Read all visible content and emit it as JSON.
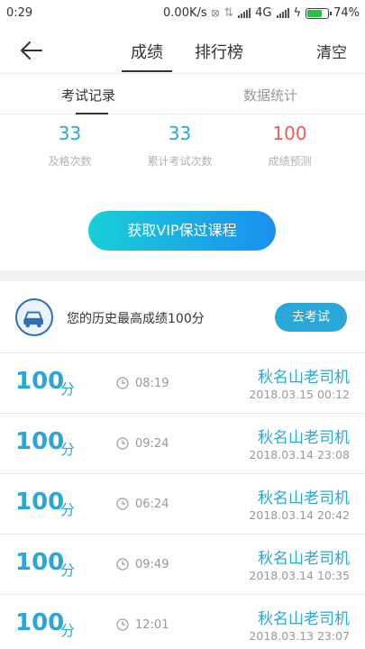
{
  "status_bar": {
    "time": "0:29",
    "speed": "0.00K/s",
    "network": "4G",
    "battery": "74%",
    "battery_level": 0.74
  },
  "header": {
    "tabs": [
      "成绩",
      "排行榜"
    ],
    "active_tab": 0,
    "clear_label": "清空"
  },
  "sub_tabs": {
    "items": [
      "考试记录",
      "数据统计"
    ],
    "active": 0
  },
  "stats": [
    {
      "value": "33",
      "label": "及格次数"
    },
    {
      "value": "33",
      "label": "累计考试次数"
    },
    {
      "value": "100",
      "label": "成绩预测"
    }
  ],
  "vip_button": "获取VIP保过课程",
  "best": {
    "text": "您的历史最高成绩100分",
    "button": "去考试"
  },
  "records": [
    {
      "score": "100",
      "unit": "分",
      "duration": "08:19",
      "name": "秋名山老司机",
      "date": "2018.03.15  00:12"
    },
    {
      "score": "100",
      "unit": "分",
      "duration": "09:24",
      "name": "秋名山老司机",
      "date": "2018.03.14  23:08"
    },
    {
      "score": "100",
      "unit": "分",
      "duration": "06:24",
      "name": "秋名山老司机",
      "date": "2018.03.14  20:42"
    },
    {
      "score": "100",
      "unit": "分",
      "duration": "09:49",
      "name": "秋名山老司机",
      "date": "2018.03.14  10:35"
    },
    {
      "score": "100",
      "unit": "分",
      "duration": "12:01",
      "name": "秋名山老司机",
      "date": "2018.03.13  23:07"
    }
  ],
  "colors": {
    "accent": "#2aa7d9",
    "prediction": "#ef5b5b",
    "battery": "#27c24c"
  }
}
